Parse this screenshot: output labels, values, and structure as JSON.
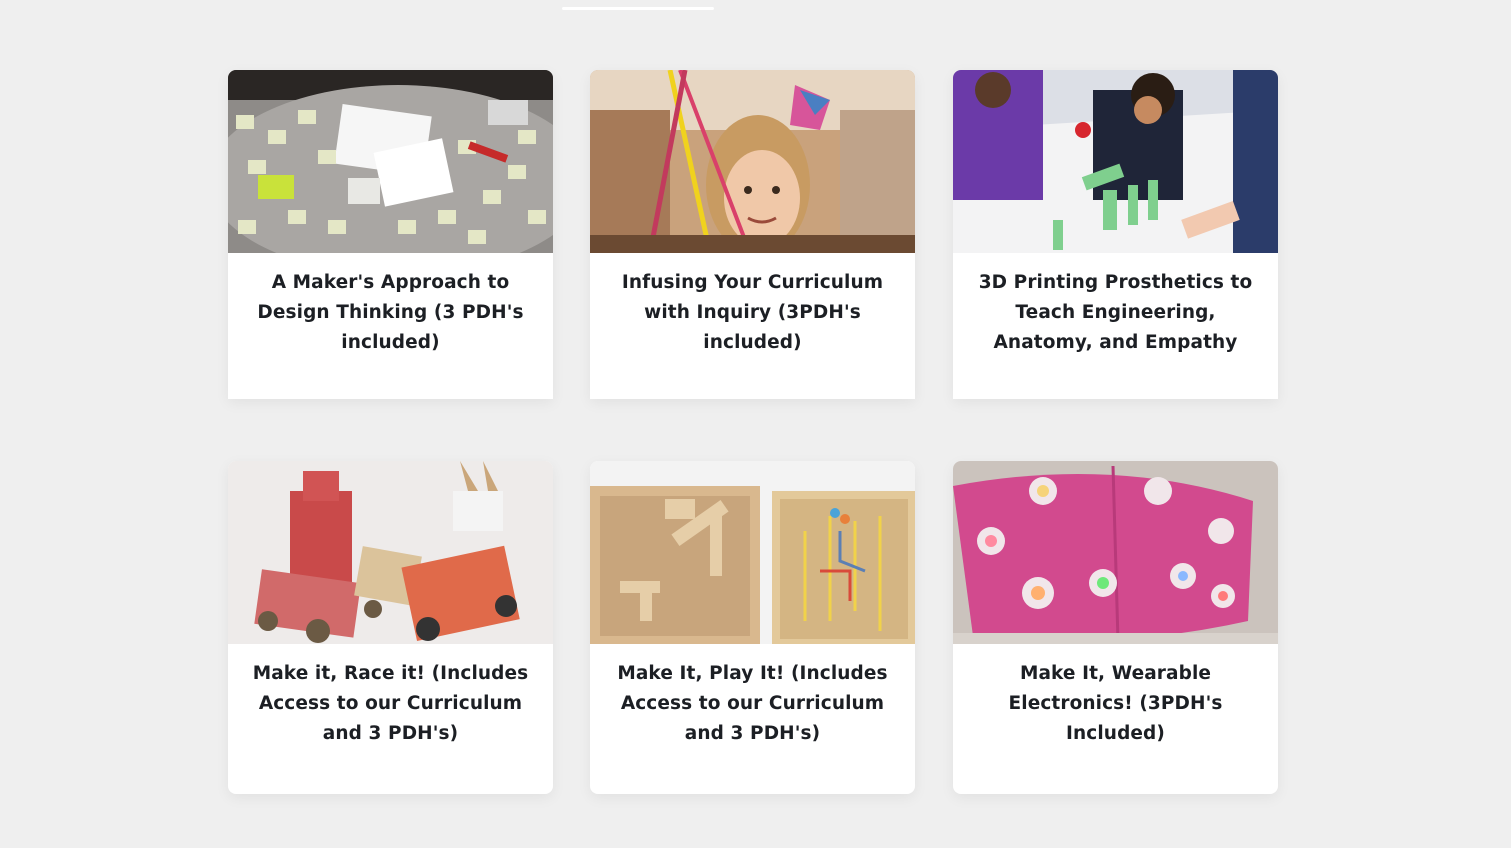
{
  "courses": [
    {
      "title": "A Maker's Approach to Design Thinking (3 PDH's included)",
      "image": "design-thinking-sticky-notes-photo"
    },
    {
      "title": "Infusing Your Curriculum with Inquiry (3PDH's included)",
      "image": "child-inquiry-photo"
    },
    {
      "title": "3D Printing Prosthetics to Teach Engineering, Anatomy, and Empathy",
      "image": "students-3d-printed-hand-photo"
    },
    {
      "title": "Make it, Race it! (Includes Access to our Curriculum and 3 PDH's)",
      "image": "cardboard-race-cars-photo"
    },
    {
      "title": "Make It, Play It! (Includes Access to our Curriculum and 3 PDH's)",
      "image": "wooden-pinball-games-photo"
    },
    {
      "title": "Make It, Wearable Electronics! (3PDH's Included)",
      "image": "led-flower-mask-photo"
    }
  ]
}
